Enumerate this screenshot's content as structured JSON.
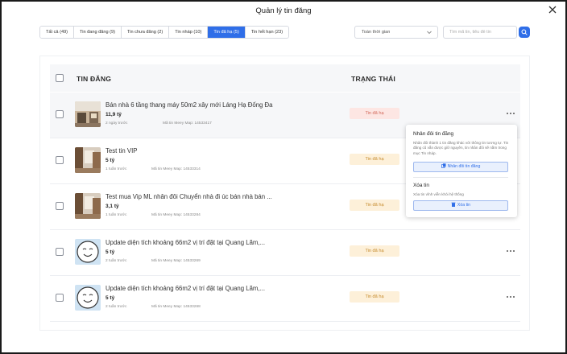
{
  "modal": {
    "title": "Quản lý tin đăng"
  },
  "tabs": [
    {
      "label": "Tất cả (49)"
    },
    {
      "label": "Tin đang đăng (9)"
    },
    {
      "label": "Tin chưa đăng (2)"
    },
    {
      "label": "Tin nháp (10)"
    },
    {
      "label": "Tin đã hạ (5)",
      "active": true
    },
    {
      "label": "Tin hết hạn (23)"
    }
  ],
  "filters": {
    "period_selected": "Toàn thời gian",
    "search_placeholder": "Tìm mã tin, tiêu đề tin"
  },
  "table": {
    "col_listing": "TIN ĐĂNG",
    "col_status": "TRẠNG THÁI",
    "rows": [
      {
        "title": "Bán nhà 6 tầng thang máy 50m2 xây mới Láng Hạ Đống Đa",
        "price": "11,9 tỷ",
        "ago": "2 ngày trước",
        "code": "Mã tin Meey Map: 14533417",
        "status": "Tin đã hạ",
        "thumb": "house"
      },
      {
        "title": "Test tin VIP",
        "price": "5 tỷ",
        "ago": "1 tuần trước",
        "code": "Mã tin Meey Map: 14533314",
        "status": "Tin đã hạ",
        "thumb": "house"
      },
      {
        "title": "Test mua Vip ML nhân đôi Chuyển nhà đi úc bán nhà bán ...",
        "price": "3,1 tỷ",
        "ago": "1 tuần trước",
        "code": "Mã tin Meey Map: 14533284",
        "status": "Tin đã hạ",
        "thumb": "house"
      },
      {
        "title": "Update diện tích khoảng 66m2 vị trí đặt tại Quang Lãm,...",
        "price": "5 tỷ",
        "ago": "2 tuần trước",
        "code": "Mã tin Meey Map: 14533269",
        "status": "Tin đã hạ",
        "thumb": "face"
      },
      {
        "title": "Update diện tích khoảng 66m2 vị trí đặt tại Quang Lãm,...",
        "price": "5 tỷ",
        "ago": "2 tuần trước",
        "code": "Mã tin Meey Map: 14533268",
        "status": "Tin đã hạ",
        "thumb": "face"
      }
    ]
  },
  "popup": {
    "dup_title": "Nhân đôi tin đăng",
    "dup_desc": "Nhân đôi thành 1 tin đăng khác với thông tin tương tự. Tin đăng cũ vẫn được giữ nguyên, tin nhân đôi sẽ nằm trong mục Tin nháp.",
    "dup_button": "Nhân đôi tin đăng",
    "del_title": "Xóa tin",
    "del_desc": "Xóa tin vĩnh viễn khỏi hệ thống",
    "del_button": "Xóa tin"
  },
  "colors": {
    "accent": "#2f6ee8",
    "status_bg": "#fdf0d9",
    "status_text": "#c58a2b"
  }
}
